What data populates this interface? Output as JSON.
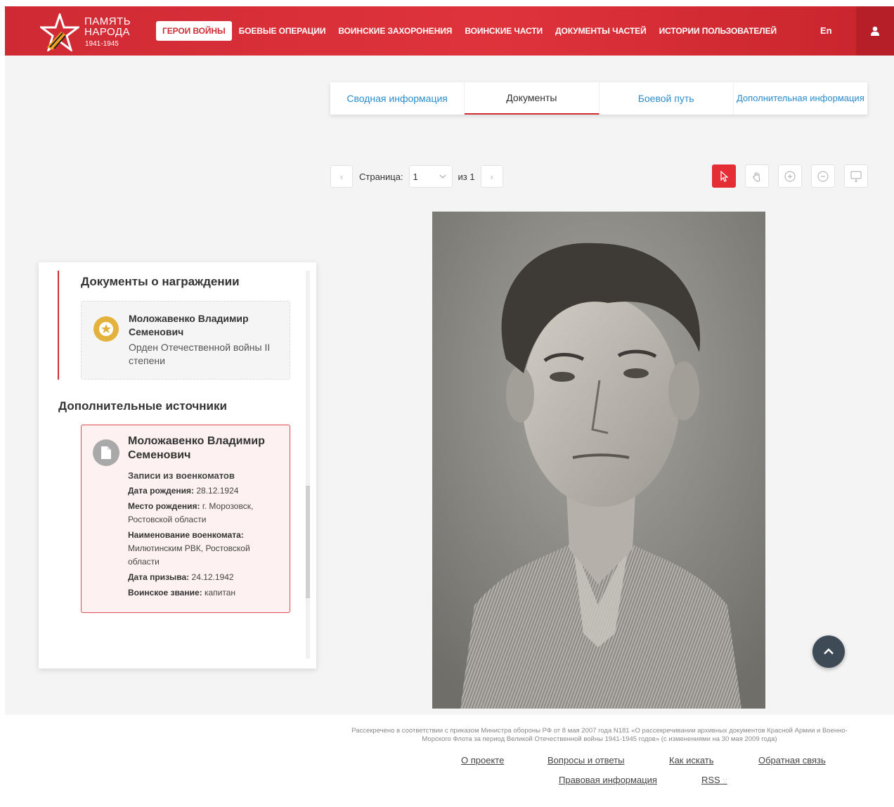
{
  "header": {
    "logo": {
      "line1": "ПАМЯТЬ",
      "line2": "НАРОДА",
      "years": "1941-1945"
    },
    "nav": [
      {
        "label": "ГЕРОИ ВОЙНЫ",
        "active": true
      },
      {
        "label": "БОЕВЫЕ ОПЕРАЦИИ",
        "active": false
      },
      {
        "label": "ВОИНСКИЕ ЗАХОРОНЕНИЯ",
        "active": false
      },
      {
        "label": "ВОИНСКИЕ ЧАСТИ",
        "active": false
      },
      {
        "label": "ДОКУМЕНТЫ ЧАСТЕЙ",
        "active": false
      },
      {
        "label": "ИСТОРИИ ПОЛЬЗОВАТЕЛЕЙ",
        "active": false
      }
    ],
    "lang": "En",
    "user_icon": "user-icon"
  },
  "tabs": [
    {
      "label": "Сводная информация",
      "active": false
    },
    {
      "label": "Документы",
      "active": true
    },
    {
      "label": "Боевой путь",
      "active": false
    },
    {
      "label": "Дополнительная информация",
      "active": false
    }
  ],
  "pager": {
    "label": "Страница:",
    "value": "1",
    "of": "из 1",
    "prev_icon": "chevron-left-icon",
    "next_icon": "chevron-right-icon"
  },
  "tools": [
    {
      "name": "cursor-tool-button",
      "icon": "pointer-icon",
      "active": true
    },
    {
      "name": "hand-tool-button",
      "icon": "hand-icon",
      "active": false
    },
    {
      "name": "zoom-in-button",
      "icon": "zoom-in-icon",
      "active": false
    },
    {
      "name": "zoom-out-button",
      "icon": "zoom-out-icon",
      "active": false
    },
    {
      "name": "fullscreen-button",
      "icon": "monitor-icon",
      "active": false
    }
  ],
  "panel": {
    "awards_title": "Документы о награждении",
    "award_card": {
      "name": "Моложавенко Владимир Семенович",
      "award": "Орден Отечественной войны II степени",
      "icon": "medal-icon"
    },
    "sources_title": "Дополнительные источники",
    "source_card": {
      "name": "Моложавенко Владимир Семенович",
      "type": "Записи из военкоматов",
      "birth_date_label": "Дата рождения:",
      "birth_date": "28.12.1924",
      "birth_place_label": "Место рождения:",
      "birth_place": "г. Морозовск, Ростовской области",
      "office_label": "Наименование военкомата:",
      "office": "Милютинским РВК, Ростовской области",
      "draft_date_label": "Дата призыва:",
      "draft_date": "24.12.1942",
      "rank_label": "Воинское звание:",
      "rank": "капитан",
      "icon": "document-icon"
    }
  },
  "footer": {
    "note": "Рассекречено в соответствии с приказом Министра обороны РФ от 8 мая 2007 года N181 «О рассекречивании архивных документов Красной Армии и Военно-Морского Флота за период Великой Отечественной войны 1941-1945 годов» (с изменениями на 30 мая 2009 года)",
    "links": [
      "О проекте",
      "Вопросы и ответы",
      "Как искать",
      "Обратная связь",
      "Правовая информация",
      "RSS"
    ]
  },
  "colors": {
    "brand_red": "#d12d36",
    "link_blue": "#2b8ccc",
    "medal_gold": "#e3b23c"
  }
}
